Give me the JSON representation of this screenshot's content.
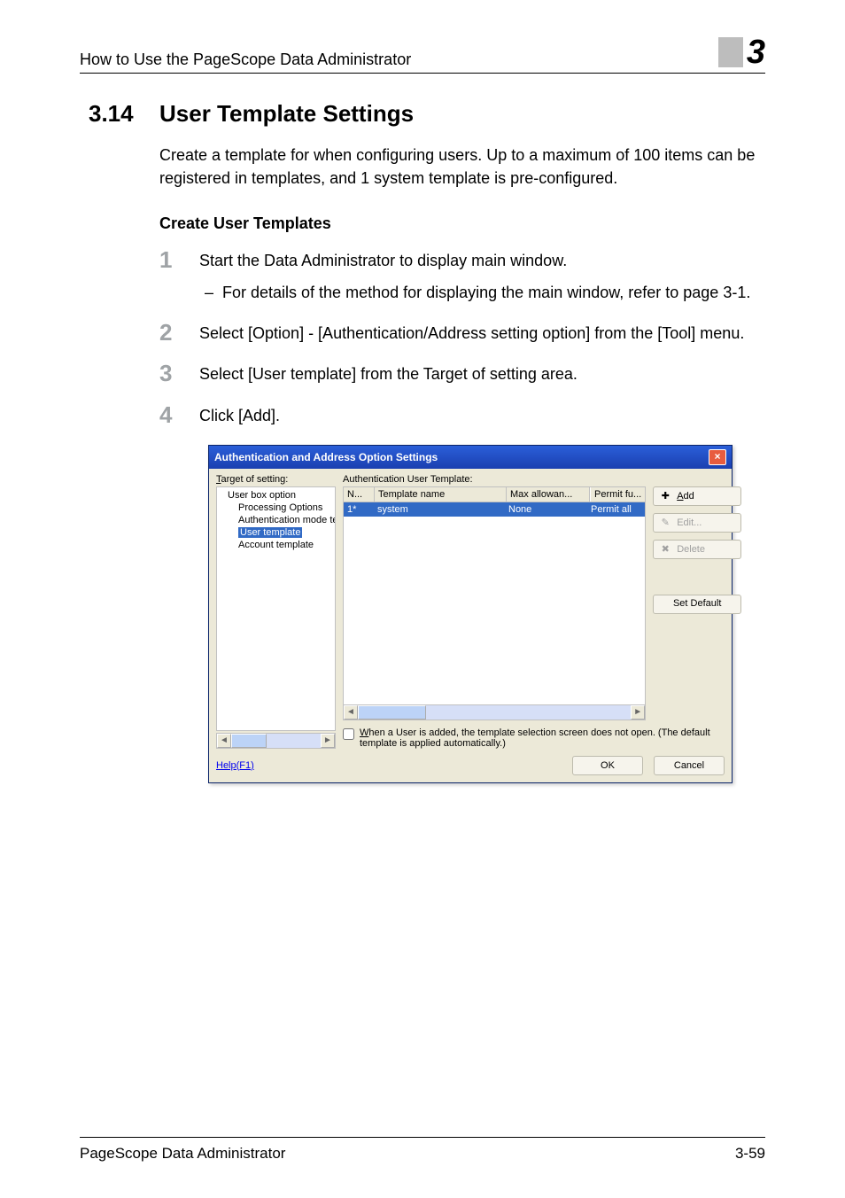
{
  "header": {
    "running_title": "How to Use the PageScope Data Administrator",
    "chapter_number": "3"
  },
  "section": {
    "number": "3.14",
    "title": "User Template Settings",
    "intro": "Create a template for when configuring users. Up to a maximum of 100 items can be registered in templates, and 1 system template is pre-configured."
  },
  "subheading": "Create User Templates",
  "steps": [
    {
      "text": "Start the Data Administrator to display main window.",
      "sub": "For details of the method for displaying the main window, refer to page 3-1."
    },
    {
      "text": "Select [Option] - [Authentication/Address setting option] from the [Tool] menu."
    },
    {
      "text": "Select [User template] from the Target of setting area."
    },
    {
      "text": "Click [Add]."
    }
  ],
  "dialog": {
    "title": "Authentication and Address Option Settings",
    "target_label": "Target of setting:",
    "tree": {
      "items": [
        {
          "label": "User box option",
          "level": 0
        },
        {
          "label": "Processing Options",
          "level": 1
        },
        {
          "label": "Authentication mode tem",
          "level": 1
        },
        {
          "label": "User template",
          "level": 1,
          "selected": true
        },
        {
          "label": "Account template",
          "level": 1
        }
      ]
    },
    "auth_label": "Authentication User Template:",
    "columns": {
      "c1": "N...",
      "c2": "Template name",
      "c3": "Max allowan...",
      "c4": "Permit fu..."
    },
    "row": {
      "c1": "1*",
      "c2": "system",
      "c3": "None",
      "c4": "Permit all"
    },
    "buttons": {
      "add": "Add",
      "edit": "Edit...",
      "delete": "Delete",
      "set_default": "Set Default"
    },
    "checkbox_text": "When a User is added, the template selection screen does not open. (The default template is applied automatically.)",
    "help": "Help(F1)",
    "ok": "OK",
    "cancel": "Cancel"
  },
  "footer": {
    "left": "PageScope Data Administrator",
    "right": "3-59"
  }
}
